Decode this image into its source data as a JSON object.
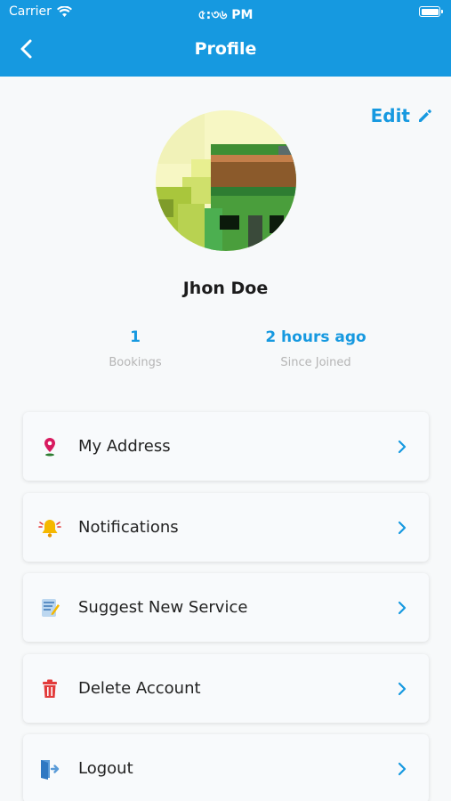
{
  "status_bar": {
    "carrier": "Carrier",
    "time": "৫:৩৬ PM"
  },
  "nav": {
    "title": "Profile",
    "back_icon": "chevron-left-icon"
  },
  "edit": {
    "label": "Edit",
    "icon": "pencil-icon"
  },
  "profile": {
    "name": "Jhon Doe"
  },
  "stats": [
    {
      "value": "1",
      "label": "Bookings"
    },
    {
      "value": "2 hours ago",
      "label": "Since Joined"
    }
  ],
  "menu": [
    {
      "label": "My Address",
      "icon": "location-pin-icon"
    },
    {
      "label": "Notifications",
      "icon": "bell-icon"
    },
    {
      "label": "Suggest New Service",
      "icon": "note-icon"
    },
    {
      "label": "Delete Account",
      "icon": "trash-icon"
    },
    {
      "label": "Logout",
      "icon": "logout-icon"
    }
  ],
  "colors": {
    "primary": "#1699e0",
    "danger": "#e23b3b",
    "background": "#f7f9fa"
  }
}
